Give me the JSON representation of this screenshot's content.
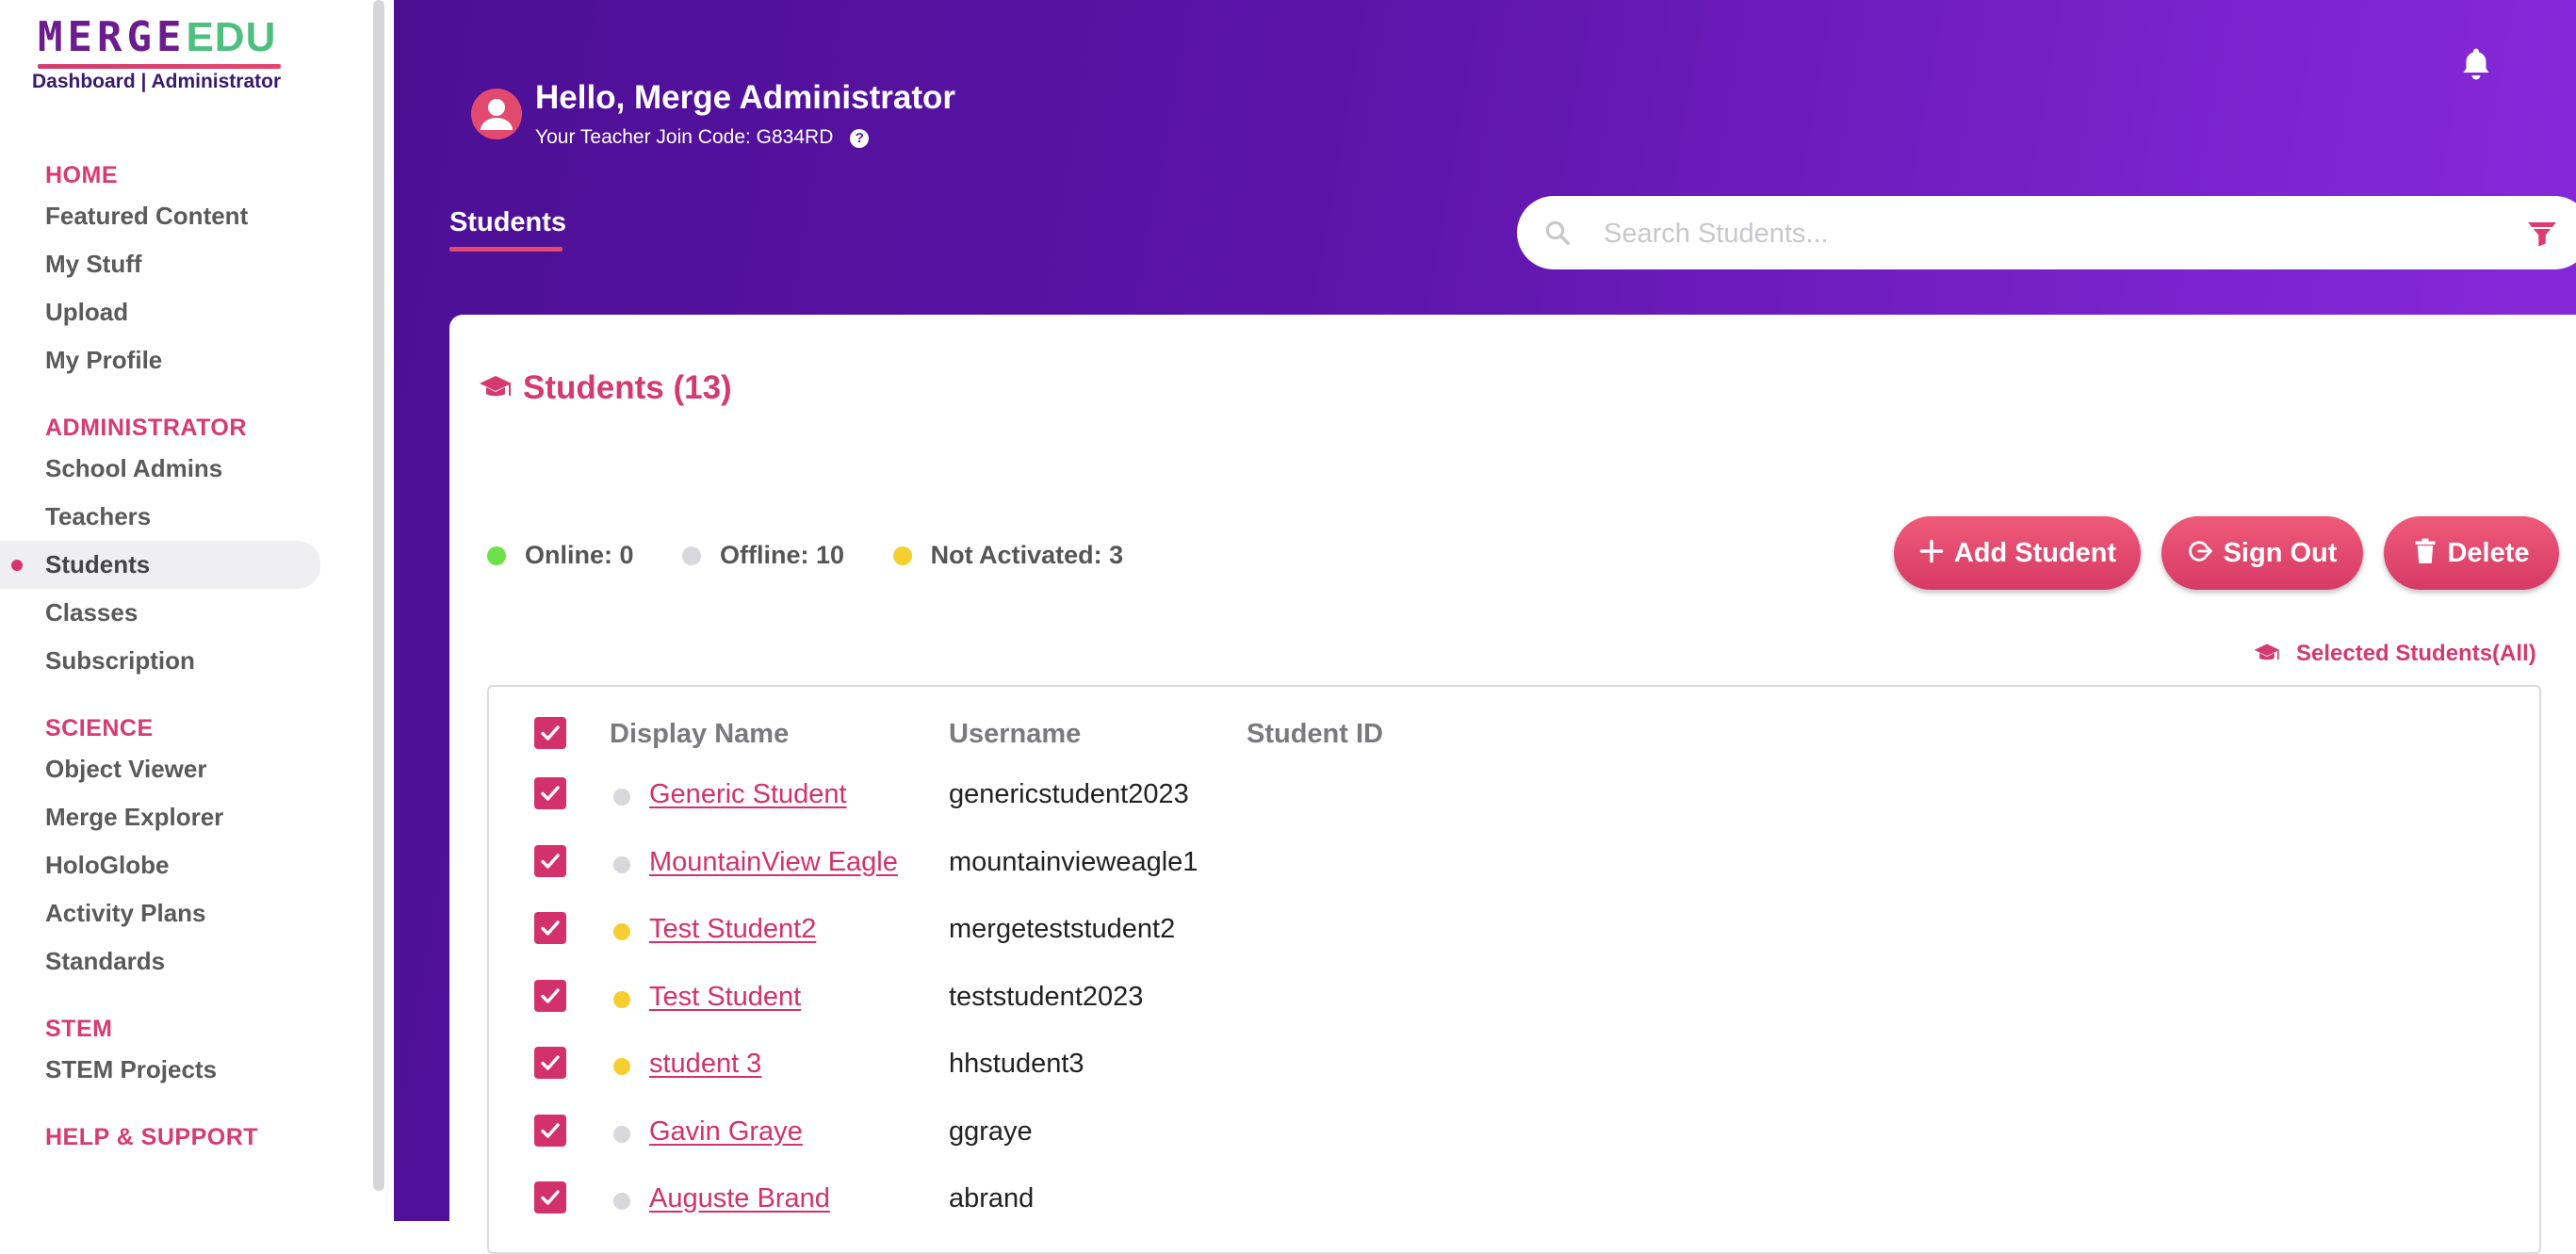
{
  "logo": {
    "merge": "MERGE",
    "edu": "EDU",
    "subtitle": "Dashboard | Administrator"
  },
  "sidebar": {
    "sections": [
      {
        "title": "HOME",
        "items": [
          "Featured Content",
          "My Stuff",
          "Upload",
          "My Profile"
        ]
      },
      {
        "title": "ADMINISTRATOR",
        "items": [
          "School Admins",
          "Teachers",
          "Students",
          "Classes",
          "Subscription"
        ]
      },
      {
        "title": "SCIENCE",
        "items": [
          "Object Viewer",
          "Merge Explorer",
          "HoloGlobe",
          "Activity Plans",
          "Standards"
        ]
      },
      {
        "title": "STEM",
        "items": [
          "STEM Projects"
        ]
      },
      {
        "title": "HELP & SUPPORT",
        "items": []
      }
    ],
    "active_item": "Students"
  },
  "header": {
    "greeting": "Hello, Merge Administrator",
    "join_code": "Your Teacher Join Code: G834RD",
    "help_glyph": "?",
    "tab": "Students",
    "search_placeholder": "Search Students..."
  },
  "card": {
    "title": "Students (13)",
    "status": {
      "online": "Online: 0",
      "offline": "Offline: 10",
      "not_activated": "Not Activated: 3"
    },
    "buttons": {
      "add": "Add Student",
      "signout": "Sign Out",
      "delete": "Delete"
    },
    "selected": "Selected Students(All)",
    "columns": {
      "name": "Display Name",
      "username": "Username",
      "student_id": "Student ID"
    },
    "rows": [
      {
        "name": "Generic Student",
        "username": "genericstudent2023",
        "status": "offline"
      },
      {
        "name": "MountainView Eagle",
        "username": "mountainvieweagle1",
        "status": "offline"
      },
      {
        "name": "Test Student2",
        "username": "mergeteststudent2",
        "status": "not_activated"
      },
      {
        "name": "Test Student",
        "username": "teststudent2023",
        "status": "not_activated"
      },
      {
        "name": "student 3",
        "username": "hhstudent3",
        "status": "not_activated"
      },
      {
        "name": "Gavin Graye",
        "username": "ggraye",
        "status": "offline"
      },
      {
        "name": "Auguste Brand",
        "username": "abrand",
        "status": "offline"
      }
    ]
  },
  "colors": {
    "accent": "#d3316b",
    "online": "#6ee04a",
    "offline": "#d8d8dc",
    "not_activated": "#f5cf2f",
    "purple_dark": "#4c0f94",
    "purple_light": "#8a2be0"
  },
  "icons": {
    "bell": "bell-icon",
    "avatar": "user-avatar-icon",
    "search": "search-icon",
    "filter": "filter-icon",
    "cap": "graduation-cap-icon",
    "plus": "plus-icon",
    "signout": "sign-out-icon",
    "trash": "trash-icon",
    "check": "checkmark-icon"
  }
}
